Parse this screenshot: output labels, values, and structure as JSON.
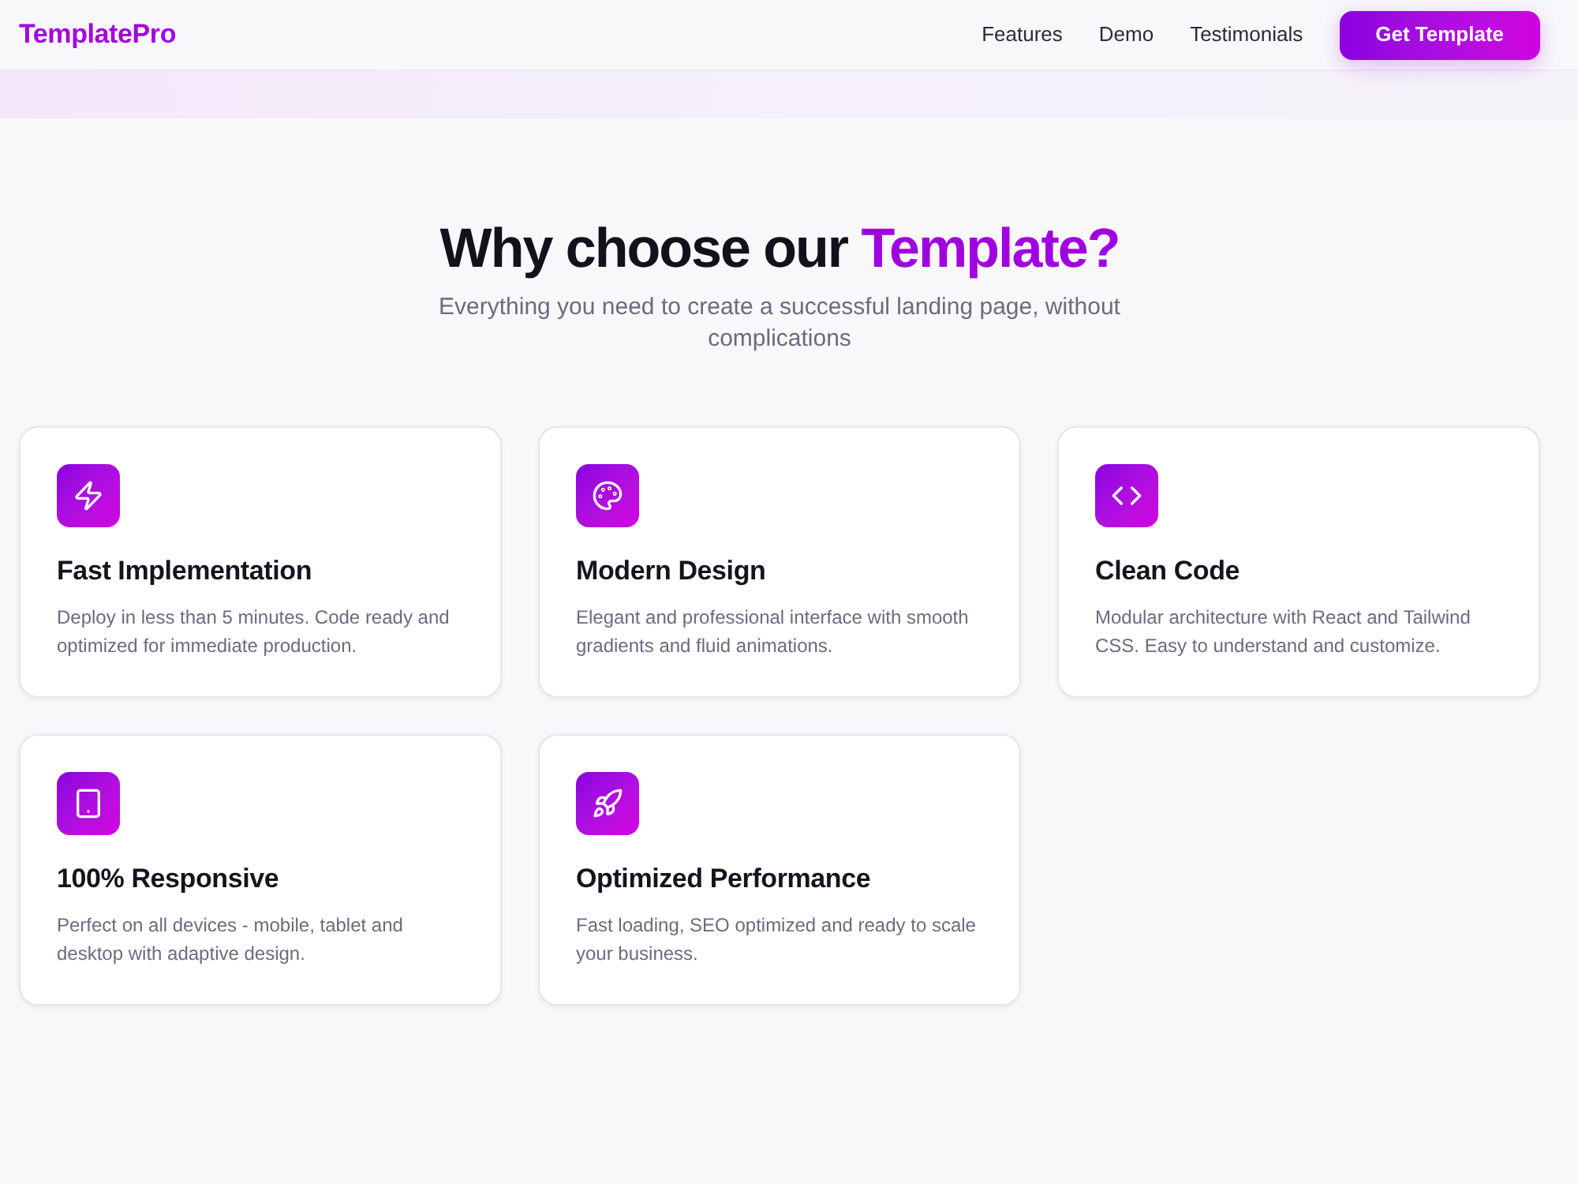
{
  "navbar": {
    "logo": "TemplatePro",
    "links": [
      "Features",
      "Demo",
      "Testimonials"
    ],
    "cta": "Get Template"
  },
  "section": {
    "heading": "Why choose our",
    "heading_highlight": "Template?",
    "subtitle": "Everything you need to create a successful landing page, without complications"
  },
  "features": [
    {
      "title": "Fast Implementation",
      "description": "Deploy in less than 5 minutes. Code ready and optimized for immediate production."
    },
    {
      "title": "Modern Design",
      "description": "Elegant and professional interface with smooth gradients and fluid animations."
    },
    {
      "title": "Clean Code",
      "description": "Modular architecture with React and Tailwind CSS. Easy to understand and customize."
    },
    {
      "title": "100% Responsive",
      "description": "Perfect on all devices - mobile, tablet and desktop with adaptive design."
    },
    {
      "title": "Optimized Performance",
      "description": "Fast loading, SEO optimized and ready to scale your business."
    }
  ]
}
